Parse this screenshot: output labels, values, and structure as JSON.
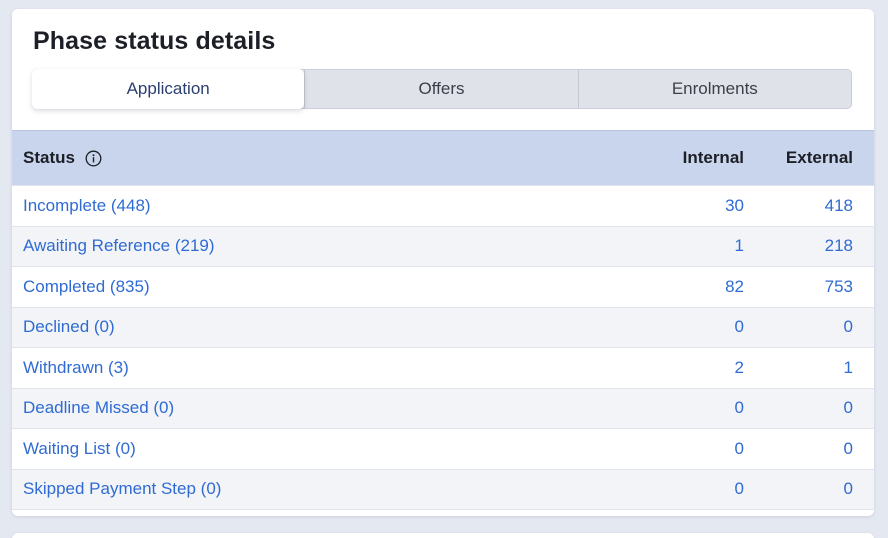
{
  "card": {
    "title": "Phase status details"
  },
  "tabs": [
    {
      "label": "Application",
      "active": true
    },
    {
      "label": "Offers",
      "active": false
    },
    {
      "label": "Enrolments",
      "active": false
    }
  ],
  "table": {
    "headers": {
      "status": "Status",
      "internal": "Internal",
      "external": "External"
    },
    "rows": [
      {
        "status": "Incomplete (448)",
        "internal": "30",
        "external": "418"
      },
      {
        "status": "Awaiting Reference (219)",
        "internal": "1",
        "external": "218"
      },
      {
        "status": "Completed (835)",
        "internal": "82",
        "external": "753"
      },
      {
        "status": "Declined (0)",
        "internal": "0",
        "external": "0"
      },
      {
        "status": "Withdrawn (3)",
        "internal": "2",
        "external": "1"
      },
      {
        "status": "Deadline Missed (0)",
        "internal": "0",
        "external": "0"
      },
      {
        "status": "Waiting List (0)",
        "internal": "0",
        "external": "0"
      },
      {
        "status": "Skipped Payment Step (0)",
        "internal": "0",
        "external": "0"
      }
    ]
  },
  "icons": {
    "status_info": "info-circle-icon"
  },
  "colors": {
    "link": "#2f6bd3",
    "header_bg": "#c9d5ec",
    "page_bg": "#e4e8f1"
  }
}
